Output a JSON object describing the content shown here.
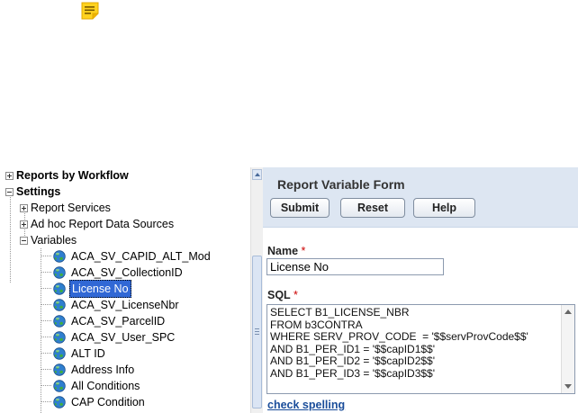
{
  "toolbar": {
    "note_icon": "note-icon"
  },
  "tree": {
    "top_items": [
      {
        "label": "Reports by Workflow",
        "expanded": false
      },
      {
        "label": "Settings",
        "expanded": true
      }
    ],
    "settings_children": [
      {
        "label": "Report Services",
        "expanded": false
      },
      {
        "label": "Ad hoc Report Data Sources",
        "expanded": false
      },
      {
        "label": "Variables",
        "expanded": true
      }
    ],
    "variables": [
      {
        "label": "ACA_SV_CAPID_ALT_Mod"
      },
      {
        "label": "ACA_SV_CollectionID"
      },
      {
        "label": "License No",
        "selected": true
      },
      {
        "label": "ACA_SV_LicenseNbr"
      },
      {
        "label": "ACA_SV_ParcelID"
      },
      {
        "label": "ACA_SV_User_SPC"
      },
      {
        "label": "ALT ID"
      },
      {
        "label": "Address Info"
      },
      {
        "label": "All Conditions"
      },
      {
        "label": "CAP Condition"
      }
    ]
  },
  "form": {
    "title": "Report Variable Form",
    "buttons": {
      "submit": "Submit",
      "reset": "Reset",
      "help": "Help"
    },
    "name_label": "Name",
    "required_mark": "*",
    "name_value": "License No",
    "sql_label": "SQL",
    "sql_lines": [
      "SELECT B1_LICENSE_NBR",
      "FROM b3CONTRA",
      "WHERE SERV_PROV_CODE  = '$$servProvCode$$'",
      "AND B1_PER_ID1 = '$$capID1$$'",
      "AND B1_PER_ID2 = '$$capID2$$'",
      "AND B1_PER_ID3 = '$$capID3$$'"
    ],
    "check_spelling": "check spelling"
  },
  "colors": {
    "selection": "#3168d5",
    "header_bg": "#dde6f2",
    "link": "#1a4d9a",
    "required": "#cc0000"
  }
}
